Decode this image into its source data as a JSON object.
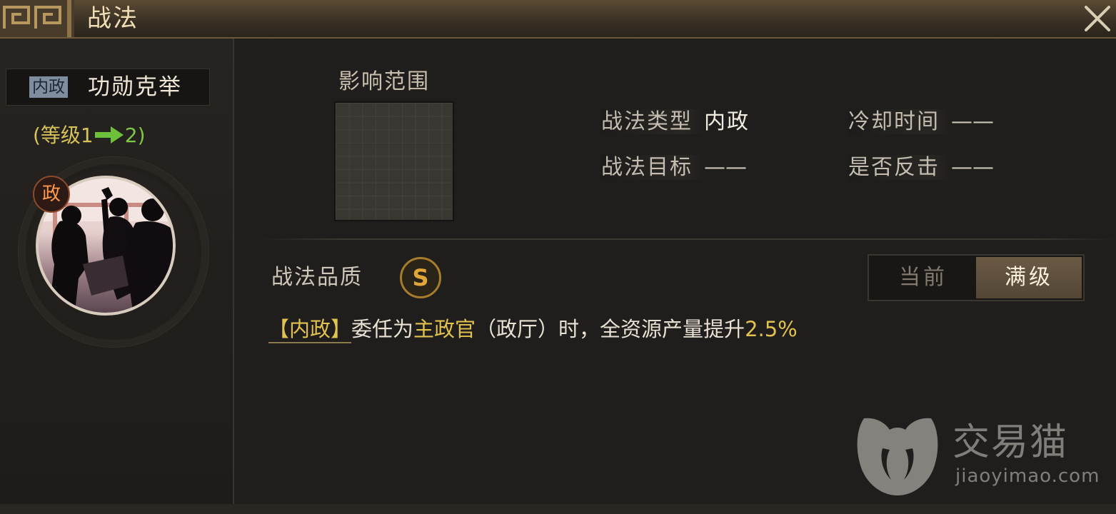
{
  "window": {
    "title": "战法",
    "close_icon": "close-icon"
  },
  "skill": {
    "type_tag": "内政",
    "name": "功勋克举",
    "level_prefix": "(等级1",
    "level_new": "2)",
    "arrow_icon": "arrow-right-icon",
    "portrait_badge": "政"
  },
  "details": {
    "range_label": "影响范围",
    "type_key": "战法类型",
    "type_value": "内政",
    "target_key": "战法目标",
    "target_value": "——",
    "cooldown_key": "冷却时间",
    "cooldown_value": "——",
    "counter_key": "是否反击",
    "counter_value": "——"
  },
  "quality": {
    "label": "战法品质",
    "grade": "S"
  },
  "toggle": {
    "current_label": "当前",
    "max_label": "满级",
    "selected": "max"
  },
  "description": {
    "tag": "【内政】",
    "part1": "委任为",
    "role": "主政官",
    "part2": "（政厅）时，全资源产量提升",
    "value": "2.5%"
  },
  "watermark": {
    "name": "交易猫",
    "url": "jiaoyimao.com"
  },
  "colors": {
    "accent_gold": "#e2c24e",
    "level_green": "#7ec744",
    "title_gold": "#f0dfb5"
  }
}
